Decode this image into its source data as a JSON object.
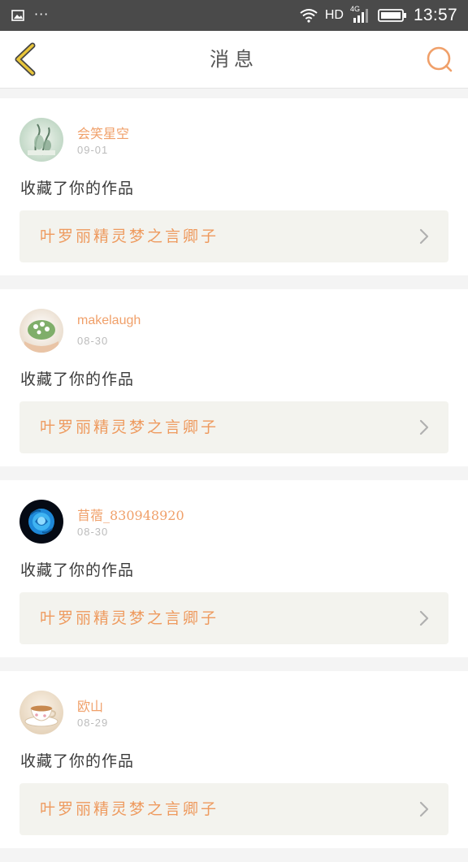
{
  "status_bar": {
    "network_label": "HD",
    "network_gen": "4G",
    "overflow": "···",
    "time": "13:57"
  },
  "nav": {
    "title": "消息"
  },
  "colors": {
    "accent": "#ee9a5e",
    "back_arrow": "#e8c53a",
    "card_bg": "#ffffff",
    "work_bg": "#f3f3ee"
  },
  "notifications": [
    {
      "username": "会笑星空",
      "date": "09-01",
      "action": "收藏了你的作品",
      "work_title": "叶罗丽精灵梦之言卿子",
      "avatar_icon": "plant-sketch-avatar"
    },
    {
      "username": "makelaugh",
      "date": "08-30",
      "action": "收藏了你的作品",
      "work_title": "叶罗丽精灵梦之言卿子",
      "avatar_icon": "hands-plant-avatar"
    },
    {
      "username": "苜蓿_830948920",
      "date": "08-30",
      "action": "收藏了你的作品",
      "work_title": "叶罗丽精灵梦之言卿子",
      "avatar_icon": "blue-rose-avatar"
    },
    {
      "username": "欧山",
      "date": "08-29",
      "action": "收藏了你的作品",
      "work_title": "叶罗丽精灵梦之言卿子",
      "avatar_icon": "teacup-avatar"
    }
  ]
}
